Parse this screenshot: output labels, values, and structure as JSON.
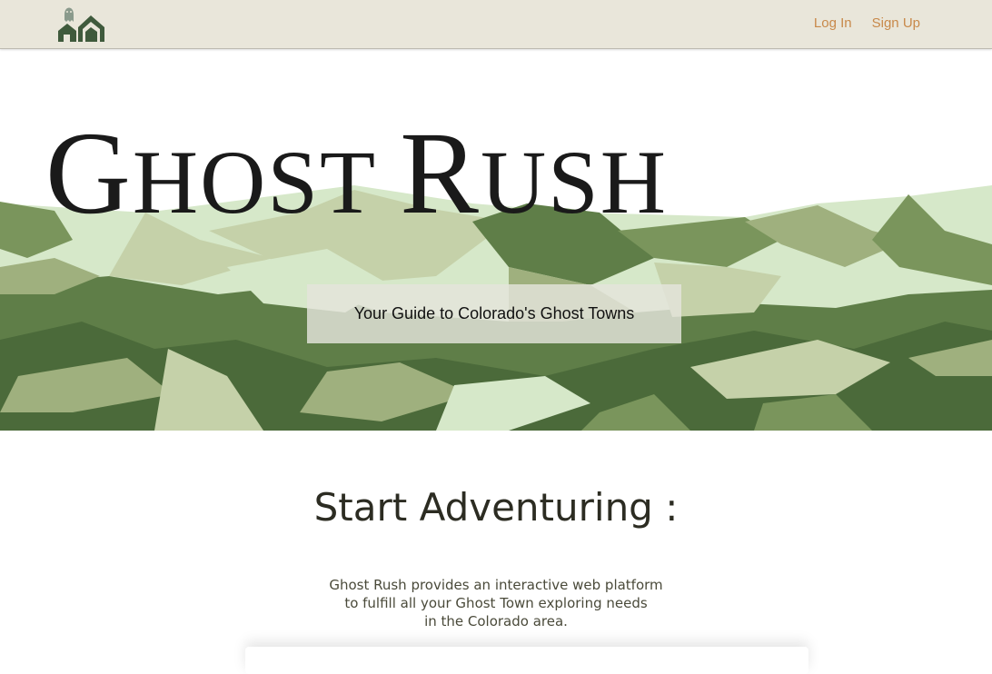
{
  "navbar": {
    "logo_icon": "ghost-houses-logo",
    "links": [
      {
        "label": "Log In"
      },
      {
        "label": "Sign Up"
      }
    ],
    "background": "#e9e6da",
    "link_color": "#c8894a"
  },
  "hero": {
    "title_parts": [
      "G",
      "HOST ",
      "R",
      "USH"
    ],
    "tagline": "Your Guide to Colorado's Ghost Towns",
    "palette": [
      "#d6e8c9",
      "#c5d1a9",
      "#9fb07e",
      "#7a955c",
      "#5f7e48",
      "#4b6a3a"
    ]
  },
  "content": {
    "heading": "Start Adventuring :",
    "description_lines": [
      "Ghost Rush provides an interactive web platform",
      "to fulfill all your Ghost Town exploring needs",
      "in the Colorado area."
    ]
  }
}
